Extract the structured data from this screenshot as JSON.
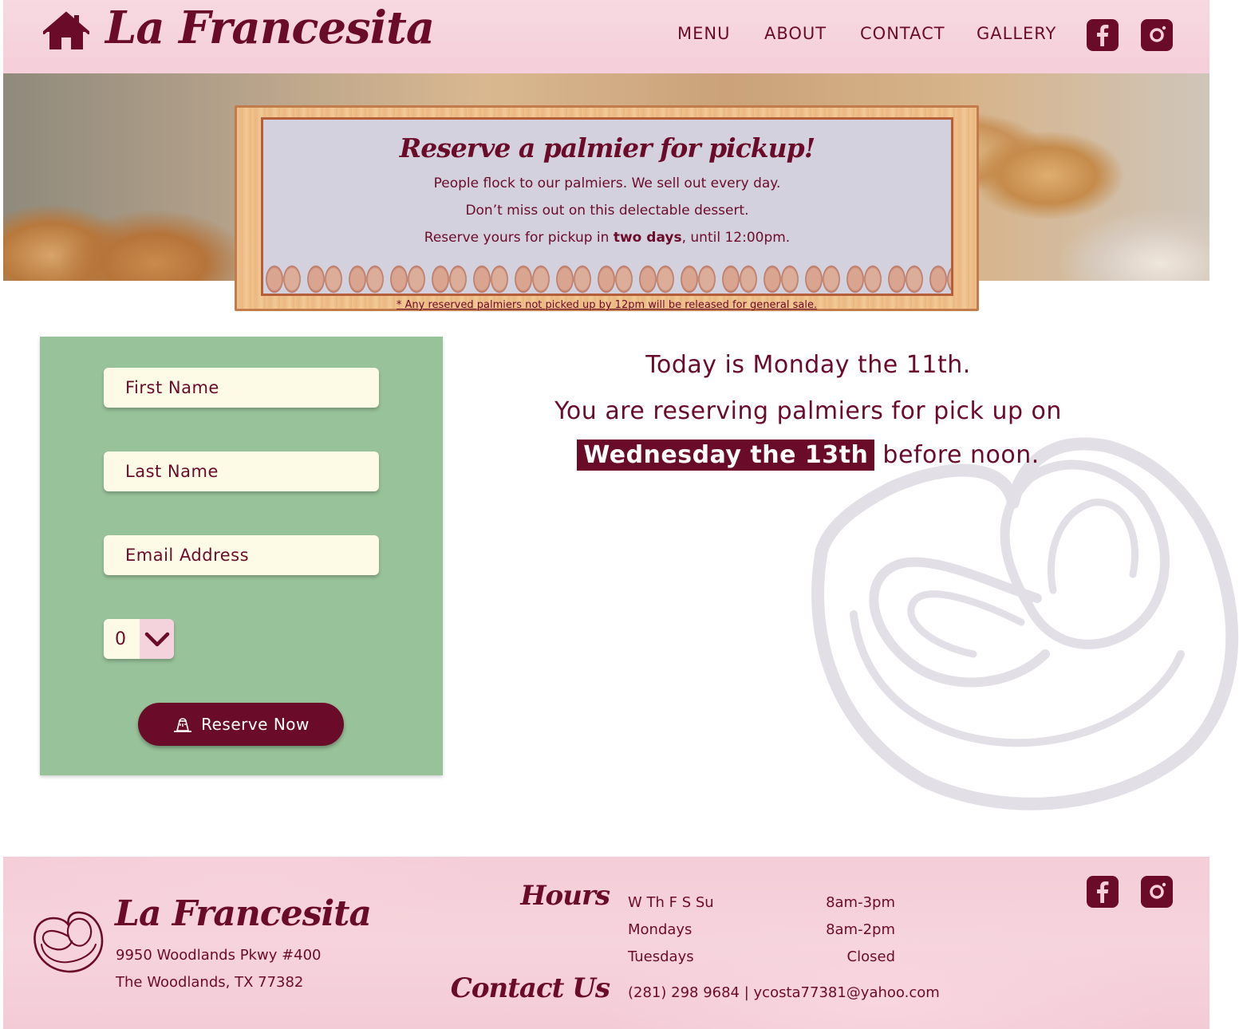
{
  "header": {
    "logo": "La Francesita",
    "home_icon": "home-icon",
    "nav": [
      "MENU",
      "ABOUT",
      "CONTACT",
      "GALLERY"
    ],
    "social": [
      "facebook-icon",
      "instagram-icon"
    ]
  },
  "board": {
    "title": "Reserve a palmier for pickup!",
    "line1": "People flock to our palmiers. We sell out every day.",
    "line2": "Don’t miss out on this delectable dessert.",
    "line3_pre": "Reserve yours for pickup in ",
    "line3_bold": "two days",
    "line3_post": ", until 12:00pm.",
    "note": "* Any reserved palmiers not picked up by 12pm will be released for general sale."
  },
  "form": {
    "first_name_placeholder": "First Name",
    "last_name_placeholder": "Last Name",
    "email_placeholder": "Email Address",
    "quantity": "0",
    "reserve_label": "Reserve Now"
  },
  "info": {
    "today": "Today is Monday the 11th.",
    "reserving": "You are reserving palmiers for pick up on",
    "pickup_date": "Wednesday the 13th",
    "before": "before noon."
  },
  "footer": {
    "logo": "La Francesita",
    "address1": "9950 Woodlands Pkwy #400",
    "address2": "The Woodlands, TX 77382",
    "hours_heading": "Hours",
    "hours": [
      {
        "days": "W Th F S Su",
        "time": "8am-3pm"
      },
      {
        "days": "Mondays",
        "time": "8am-2pm"
      },
      {
        "days": "Tuesdays",
        "time": "Closed"
      }
    ],
    "contact_heading": "Contact Us",
    "contact": "(281) 298 9684 | ycosta77381@yahoo.com"
  },
  "colors": {
    "brand": "#6b0b2a",
    "header_pink": "#f5cfd9",
    "form_green": "#98c29a",
    "field_cream": "#fdfbe6",
    "board_lavender": "#d4d1de"
  }
}
